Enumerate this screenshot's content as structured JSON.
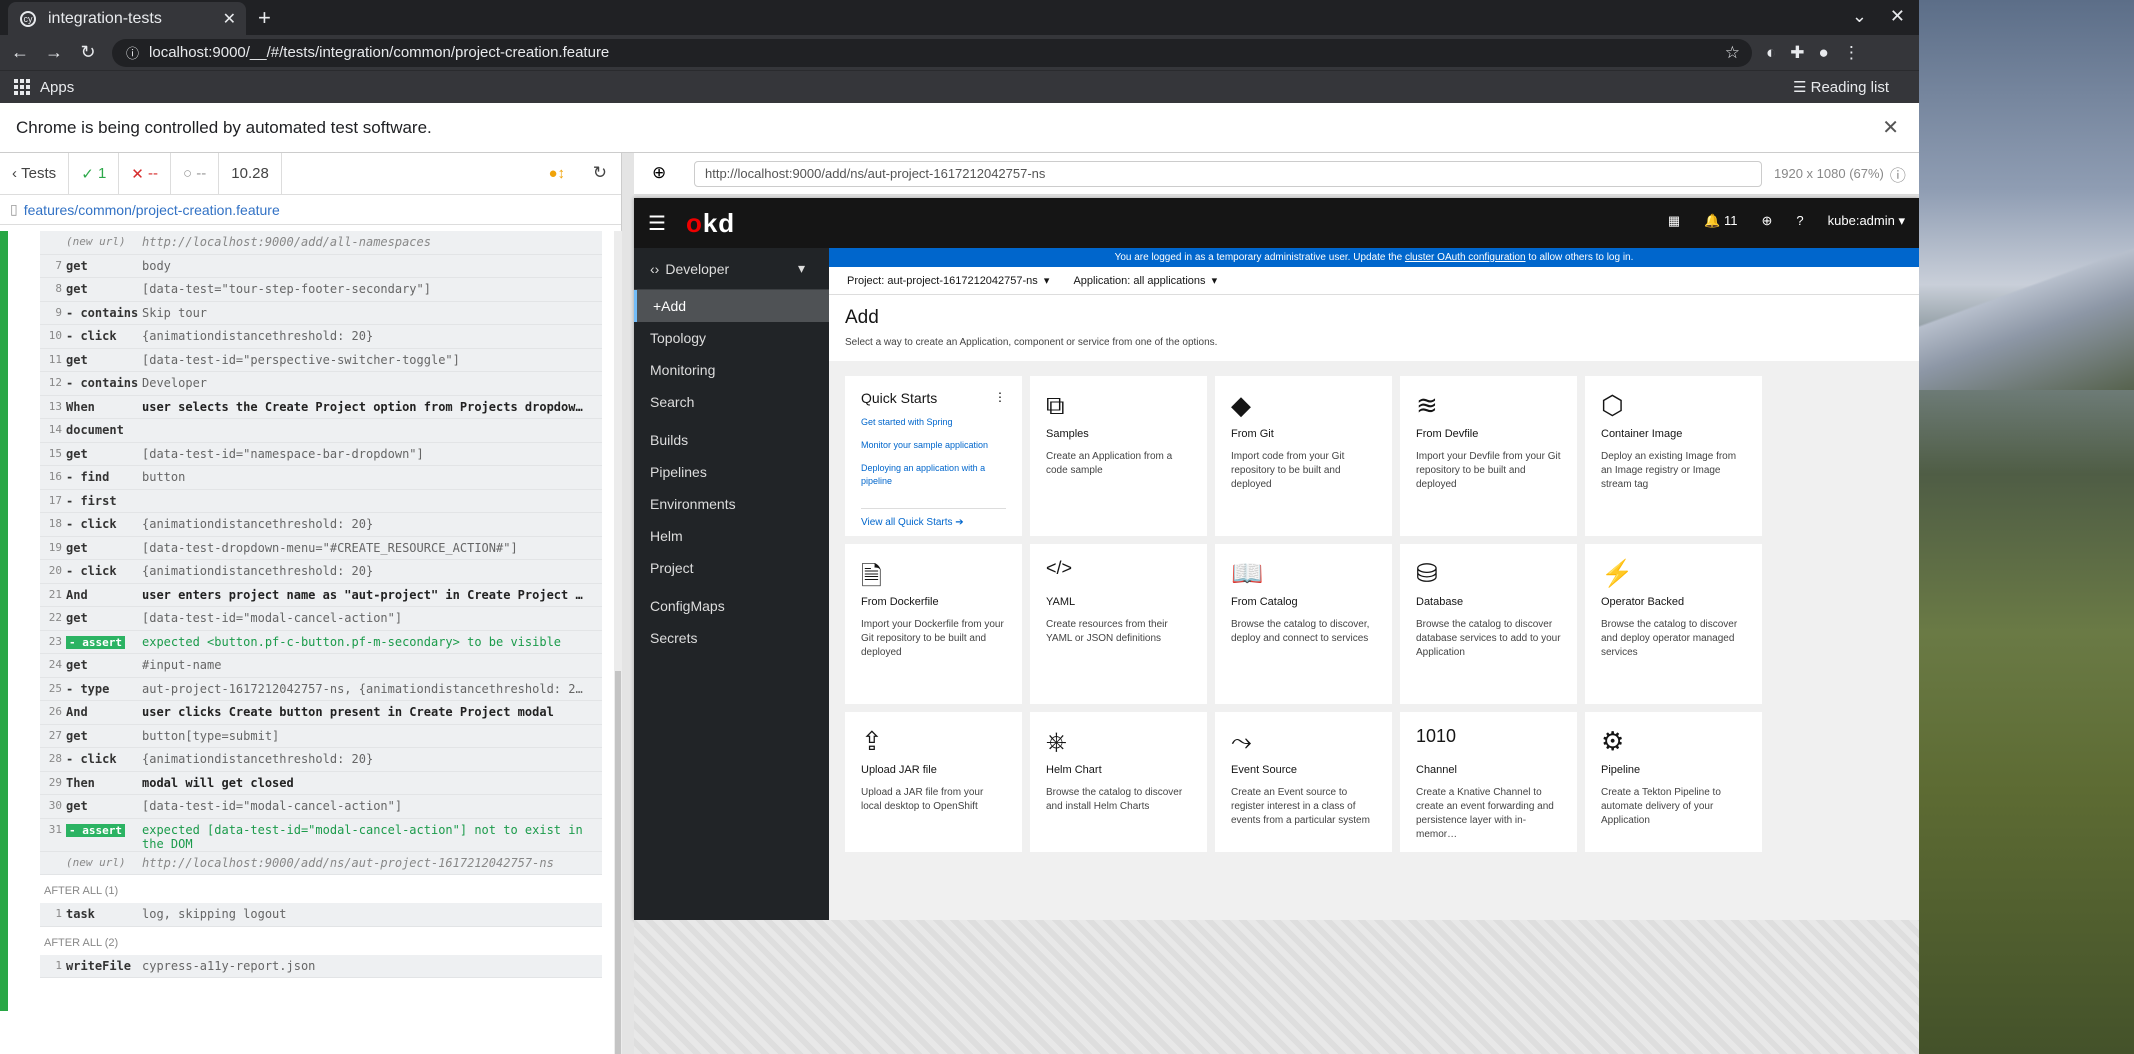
{
  "browser": {
    "tab_title": "integration-tests",
    "url": "localhost:9000/__/#/tests/integration/common/project-creation.feature",
    "apps_label": "Apps",
    "reading_list": "Reading list",
    "automation_notice": "Chrome is being controlled by automated test software."
  },
  "runner": {
    "tests_label": "Tests",
    "passed": "1",
    "failed": "--",
    "pending": "--",
    "duration": "10.28",
    "spec_path": "features/common/project-creation.feature",
    "aut_url": "http://localhost:9000/add/ns/aut-project-1617212042757-ns",
    "viewport": "1920 x 1080",
    "zoom": "(67%)"
  },
  "commands": [
    {
      "n": "",
      "name": "(new url)",
      "msg": "http://localhost:9000/add/all-namespaces",
      "kind": "url"
    },
    {
      "n": "7",
      "name": "get",
      "msg": "body"
    },
    {
      "n": "8",
      "name": "get",
      "msg": "[data-test=\"tour-step-footer-secondary\"]"
    },
    {
      "n": "9",
      "name": "- contains",
      "msg": "Skip tour"
    },
    {
      "n": "10",
      "name": "- click",
      "msg": "{animationdistancethreshold: 20}"
    },
    {
      "n": "11",
      "name": "get",
      "msg": "[data-test-id=\"perspective-switcher-toggle\"]"
    },
    {
      "n": "12",
      "name": "- contains",
      "msg": "Developer"
    },
    {
      "n": "13",
      "name": "When",
      "msg": "user selects the Create Project option from Projects dropdow…",
      "kind": "step"
    },
    {
      "n": "14",
      "name": "document",
      "msg": ""
    },
    {
      "n": "15",
      "name": "get",
      "msg": "[data-test-id=\"namespace-bar-dropdown\"]"
    },
    {
      "n": "16",
      "name": "- find",
      "msg": "button"
    },
    {
      "n": "17",
      "name": "- first",
      "msg": ""
    },
    {
      "n": "18",
      "name": "- click",
      "msg": "{animationdistancethreshold: 20}"
    },
    {
      "n": "19",
      "name": "get",
      "msg": "[data-test-dropdown-menu=\"#CREATE_RESOURCE_ACTION#\"]"
    },
    {
      "n": "20",
      "name": "- click",
      "msg": "{animationdistancethreshold: 20}"
    },
    {
      "n": "21",
      "name": "And",
      "msg": "user enters project name as \"aut-project\" in Create Project …",
      "kind": "step"
    },
    {
      "n": "22",
      "name": "get",
      "msg": "[data-test-id=\"modal-cancel-action\"]"
    },
    {
      "n": "23",
      "name": "- assert",
      "msg": "expected <button.pf-c-button.pf-m-secondary> to be visible",
      "kind": "assert"
    },
    {
      "n": "24",
      "name": "get",
      "msg": "#input-name"
    },
    {
      "n": "25",
      "name": "- type",
      "msg": "aut-project-1617212042757-ns, {animationdistancethreshold: 2…"
    },
    {
      "n": "26",
      "name": "And",
      "msg": "user clicks Create button present in Create Project modal",
      "kind": "step"
    },
    {
      "n": "27",
      "name": "get",
      "msg": "button[type=submit]"
    },
    {
      "n": "28",
      "name": "- click",
      "msg": "{animationdistancethreshold: 20}"
    },
    {
      "n": "29",
      "name": "Then",
      "msg": "modal will get closed",
      "kind": "step"
    },
    {
      "n": "30",
      "name": "get",
      "msg": "[data-test-id=\"modal-cancel-action\"]"
    },
    {
      "n": "31",
      "name": "- assert",
      "msg": "expected [data-test-id=\"modal-cancel-action\"] not to exist in the DOM",
      "kind": "assert"
    },
    {
      "n": "",
      "name": "(new url)",
      "msg": "http://localhost:9000/add/ns/aut-project-1617212042757-ns",
      "kind": "url"
    }
  ],
  "hooks": [
    {
      "label": "AFTER ALL (1)",
      "rows": [
        {
          "n": "1",
          "name": "task",
          "msg": "log, skipping logout"
        }
      ]
    },
    {
      "label": "AFTER ALL (2)",
      "rows": [
        {
          "n": "1",
          "name": "writeFile",
          "msg": "cypress-a11y-report.json"
        }
      ]
    }
  ],
  "okd": {
    "brand_o": "o",
    "brand_kd": "kd",
    "notifications": "11",
    "user": "kube:admin",
    "perspective": "Developer",
    "banner_pre": "You are logged in as a temporary administrative user. Update the ",
    "banner_link": "cluster OAuth configuration",
    "banner_post": " to allow others to log in.",
    "project": "Project: aut-project-1617212042757-ns",
    "application": "Application: all applications",
    "nav": [
      "+Add",
      "Topology",
      "Monitoring",
      "Search",
      "Builds",
      "Pipelines",
      "Environments",
      "Helm",
      "Project",
      "ConfigMaps",
      "Secrets"
    ],
    "add_title": "Add",
    "add_subtitle": "Select a way to create an Application, component or service from one of the options.",
    "quickstarts": {
      "title": "Quick Starts",
      "links": [
        "Get started with Spring",
        "Monitor your sample application",
        "Deploying an application with a pipeline"
      ],
      "view_all": "View all Quick Starts"
    },
    "cards": [
      {
        "icon": "samples-icon",
        "glyph": "⧉",
        "t": "Samples",
        "d": "Create an Application from a code sample"
      },
      {
        "icon": "git-icon",
        "glyph": "◆",
        "t": "From Git",
        "d": "Import code from your Git repository to be built and deployed"
      },
      {
        "icon": "devfile-icon",
        "glyph": "≋",
        "t": "From Devfile",
        "d": "Import your Devfile from your Git repository to be built and deployed"
      },
      {
        "icon": "container-image-icon",
        "glyph": "⬡",
        "t": "Container Image",
        "d": "Deploy an existing Image from an Image registry or Image stream tag"
      },
      {
        "icon": "dockerfile-icon",
        "glyph": "🗎",
        "t": "From Dockerfile",
        "d": "Import your Dockerfile from your Git repository to be built and deployed"
      },
      {
        "icon": "yaml-icon",
        "glyph": "</>",
        "t": "YAML",
        "d": "Create resources from their YAML or JSON definitions"
      },
      {
        "icon": "catalog-icon",
        "glyph": "📖",
        "t": "From Catalog",
        "d": "Browse the catalog to discover, deploy and connect to services"
      },
      {
        "icon": "database-icon",
        "glyph": "⛁",
        "t": "Database",
        "d": "Browse the catalog to discover database services to add to your Application"
      },
      {
        "icon": "operator-icon",
        "glyph": "⚡",
        "t": "Operator Backed",
        "d": "Browse the catalog to discover and deploy operator managed services"
      },
      {
        "icon": "upload-jar-icon",
        "glyph": "⇪",
        "t": "Upload JAR file",
        "d": "Upload a JAR file from your local desktop to OpenShift"
      },
      {
        "icon": "helm-icon",
        "glyph": "⎈",
        "t": "Helm Chart",
        "d": "Browse the catalog to discover and install Helm Charts"
      },
      {
        "icon": "event-source-icon",
        "glyph": "⤳",
        "t": "Event Source",
        "d": "Create an Event source to register interest in a class of events from a particular system"
      },
      {
        "icon": "channel-icon",
        "glyph": "1010",
        "t": "Channel",
        "d": "Create a Knative Channel to create an event forwarding and persistence layer with in-memor…"
      },
      {
        "icon": "pipeline-icon",
        "glyph": "⚙",
        "t": "Pipeline",
        "d": "Create a Tekton Pipeline to automate delivery of your Application"
      }
    ]
  }
}
